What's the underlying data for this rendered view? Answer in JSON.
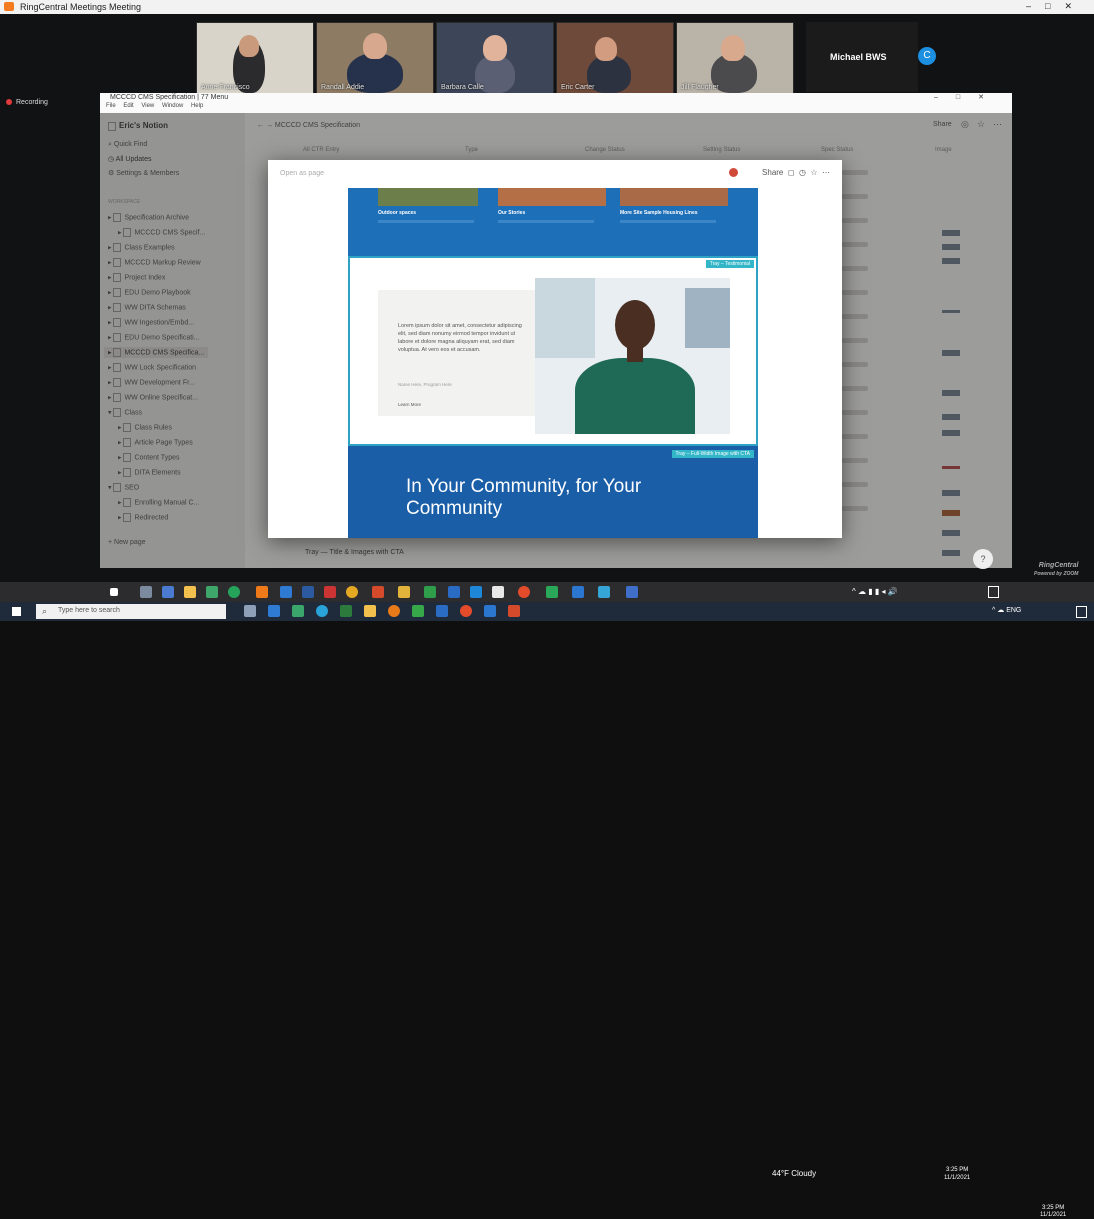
{
  "outer_window": {
    "title": "RingCentral Meetings Meeting",
    "controls": [
      "–",
      "□",
      "✕"
    ],
    "recording_label": "Recording"
  },
  "participants": [
    {
      "name": "Anne Francisco"
    },
    {
      "name": "Randall Addie"
    },
    {
      "name": "Barbara Calle"
    },
    {
      "name": "Eric Carter"
    },
    {
      "name": "Jill Flaugher"
    }
  ],
  "speaker_tile": {
    "name": "Michael BWS",
    "avatar_letter": "C"
  },
  "notion": {
    "window_title": "MCCCD CMS Specification | 77 Menu",
    "menu": [
      "File",
      "Edit",
      "View",
      "Window",
      "Help"
    ],
    "window_controls": [
      "–",
      "□",
      "✕"
    ],
    "breadcrumb": "MCCCD CMS Specification",
    "workspace": "Eric's Notion",
    "sidebar_top": [
      "Quick Find",
      "All Updates",
      "Settings & Members"
    ],
    "section_label": "WORKSPACE",
    "sidebar_pages": [
      "Specification Archive",
      "MCCCD CMS Specif...",
      "Class Examples",
      "MCCCD Markup Review",
      "Project Index",
      "EDU Demo Playbook",
      "WW DITA Schemas",
      "WW Ingestion/Embd...",
      "EDU Demo Specificati...",
      "MCCCD CMS Specifica...",
      "WW Lock Specification",
      "WW Development Fr...",
      "WW Online Specificat...",
      "Class",
      "Class Rules",
      "Article Page Types",
      "Content Types",
      "DITA Elements",
      "SEO",
      "Enrolling Manual C...",
      "Redirected"
    ],
    "new_page": "New page",
    "share_label": "Share",
    "columns": [
      "All CTR Entry",
      "Type",
      "Change Status",
      "Setting Status",
      "Spec Status",
      "Image"
    ],
    "bottom_row": "Tray — Title & Images with CTA"
  },
  "modal": {
    "open_as_page": "Open as page",
    "share": "Share",
    "cards": [
      {
        "title": "Outdoor spaces"
      },
      {
        "title": "Our Stories"
      },
      {
        "title": "More Site Sample Housing Lines"
      }
    ],
    "tag_top": "Tray – Testimonial",
    "quote": "Lorem ipsum dolor sit amet, consectetur adipiscing elit, sed diam nonumy eirmod tempor invidunt ut labore et dolore magna aliquyam erat, sed diam voluptua. At vero eos et accusam.",
    "quote_attribution": "Name Here, Program Here",
    "learn_more": "Learn More",
    "tag_bottom": "Tray – Full-Width Image with CTA",
    "headline": "In Your Community, for Your Community"
  },
  "taskbar": {
    "search_placeholder": "Type here to search",
    "weather": "44°F Cloudy",
    "time_top": "3:25 PM",
    "date_top": "11/1/2021",
    "time_bottom": "3:25 PM",
    "date_bottom": "11/1/2021",
    "language": "ENG"
  },
  "brand": {
    "line1": "RingCentral",
    "line2": "Powered by ZOOM"
  },
  "help_label": "?",
  "colors": {
    "accent_blue": "#1d6fb8",
    "teal_tag": "#34b6c9",
    "recording_red": "#e23b3b"
  }
}
